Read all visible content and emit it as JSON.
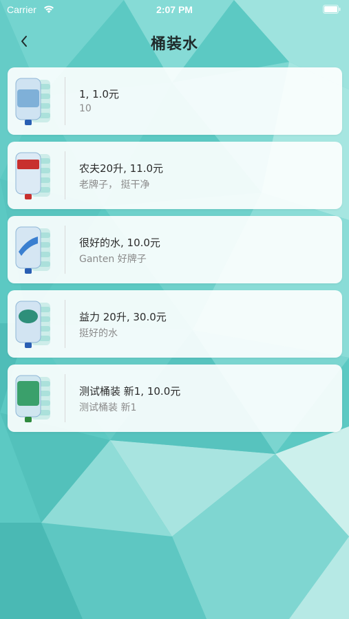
{
  "status_bar": {
    "carrier": "Carrier",
    "time": "2:07 PM"
  },
  "nav": {
    "title": "桶装水",
    "back_icon": "chevron-left-icon"
  },
  "colors": {
    "background": "#5cc9c3",
    "card": "#ffffff",
    "title_text": "#1f2b2b",
    "subtitle_text": "#8a8a8a"
  },
  "products": [
    {
      "title": "1, 1.0元",
      "subtitle": "10",
      "label_color": "#7fb0d8",
      "cap_color": "#2a5fb3"
    },
    {
      "title": "农夫20升, 11.0元",
      "subtitle": "老牌子， 挺干净",
      "label_color": "#c8302f",
      "cap_color": "#c8302f"
    },
    {
      "title": "很好的水, 10.0元",
      "subtitle": "Ganten 好牌子",
      "label_color": "#3a7fd0",
      "cap_color": "#2a5fb3"
    },
    {
      "title": "益力 20升, 30.0元",
      "subtitle": "挺好的水",
      "label_color": "#2e8f7a",
      "cap_color": "#2a5fb3"
    },
    {
      "title": "测试桶装 新1, 10.0元",
      "subtitle": "测试桶装 新1",
      "label_color": "#3aa06b",
      "cap_color": "#2f8a3f"
    }
  ]
}
